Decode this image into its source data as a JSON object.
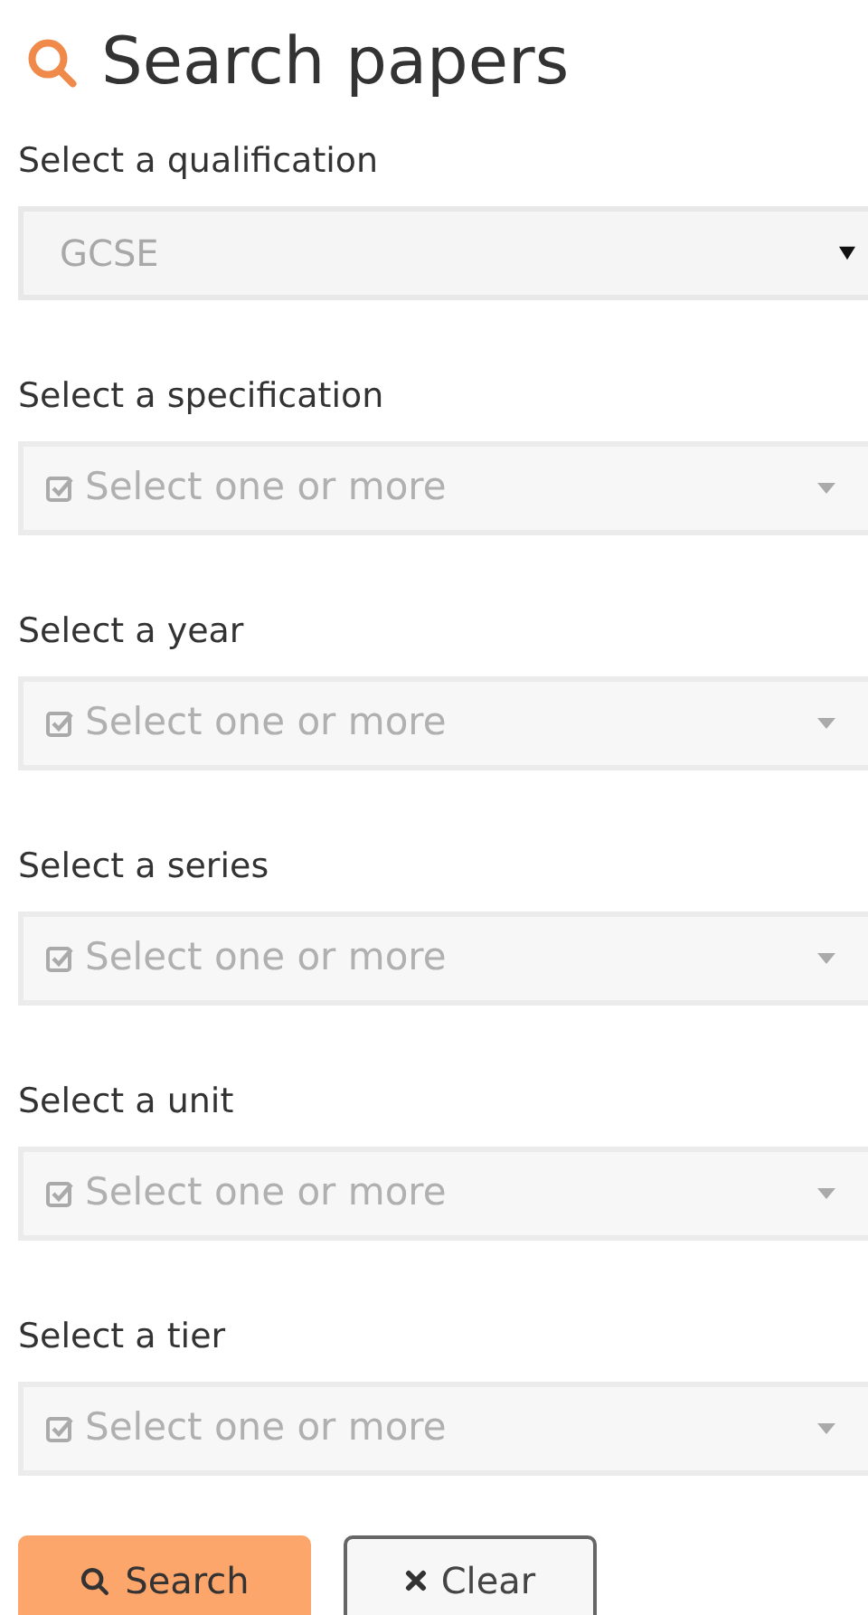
{
  "title": "Search papers",
  "fields": [
    {
      "label": "Select a qualification",
      "kind": "select",
      "value": "GCSE"
    },
    {
      "label": "Select a specification",
      "kind": "multiselect",
      "placeholder": "Select one or more"
    },
    {
      "label": "Select a year",
      "kind": "multiselect",
      "placeholder": "Select one or more"
    },
    {
      "label": "Select a series",
      "kind": "multiselect",
      "placeholder": "Select one or more"
    },
    {
      "label": "Select a unit",
      "kind": "multiselect",
      "placeholder": "Select one or more"
    },
    {
      "label": "Select a tier",
      "kind": "multiselect",
      "placeholder": "Select one or more"
    }
  ],
  "buttons": [
    {
      "label": "Search",
      "kind": "primary"
    },
    {
      "label": "Clear",
      "kind": "secondary"
    }
  ]
}
